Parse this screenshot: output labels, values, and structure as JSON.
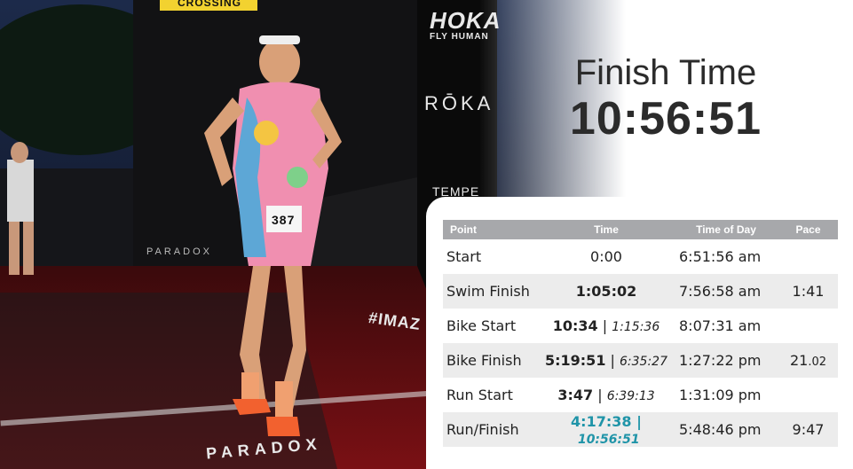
{
  "photo": {
    "brand_sign_top": "HOKA",
    "brand_sign_sub": "FLY HUMAN",
    "roka_sign": "RŌKA",
    "tempe_sign": "TEMPE",
    "banner_top": "CROSSING",
    "bib_number": "387",
    "hashtag_sign": "#IMAZ",
    "carpet_brand": "PARADOX",
    "barrier_brand": "PARADOX"
  },
  "finish": {
    "label": "Finish Time",
    "value": "10:56:51"
  },
  "splits": {
    "headers": [
      "Point",
      "Time",
      "Time of Day",
      "Pace"
    ],
    "rows": [
      {
        "point": "Start",
        "time": "0:00",
        "cum": "",
        "tod": "6:51:56 am",
        "pace": "",
        "pace_dec": ""
      },
      {
        "point": "Swim Finish",
        "time": "1:05:02",
        "cum": "",
        "tod": "7:56:58 am",
        "pace": "1:41",
        "pace_dec": ""
      },
      {
        "point": "Bike Start",
        "time": "10:34",
        "cum": "1:15:36",
        "tod": "8:07:31 am",
        "pace": "",
        "pace_dec": ""
      },
      {
        "point": "Bike Finish",
        "time": "5:19:51",
        "cum": "6:35:27",
        "tod": "1:27:22 pm",
        "pace": "21",
        "pace_dec": ".02"
      },
      {
        "point": "Run Start",
        "time": "3:47",
        "cum": "6:39:13",
        "tod": "1:31:09 pm",
        "pace": "",
        "pace_dec": ""
      },
      {
        "point": "Run/Finish",
        "time": "4:17:38",
        "cum": "10:56:51",
        "tod": "5:48:46 pm",
        "pace": "9:47",
        "pace_dec": ""
      }
    ]
  },
  "colors": {
    "accent": "#2a8c9a",
    "final_accent": "#1f94a8",
    "header_bg": "#a7a8ab",
    "row_alt": "#ececec",
    "text": "#2b2b2b"
  }
}
